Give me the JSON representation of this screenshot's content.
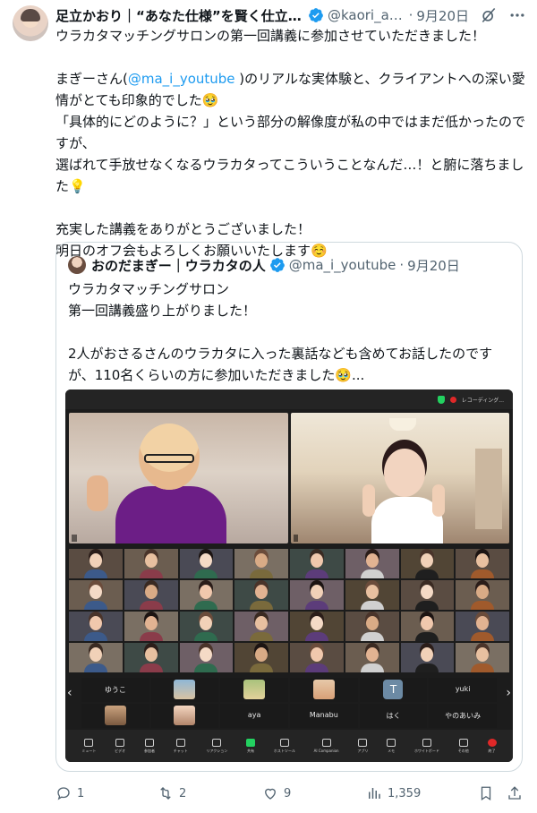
{
  "author": {
    "name": "足立かおり｜“あなた仕様”を賢く仕立て...",
    "handle": "@kaori_as...",
    "dot": "·",
    "date": "9月20日"
  },
  "tweet": {
    "line1": "ウラカタマッチングサロンの第一回講義に参加させていただきました！\n\nまぎーさん(",
    "mention": "@ma_i_youtube",
    "line2": " )のリアルな実体験と、クライアントへの深い愛情がとても印象的でした🥹\n「具体的にどのように？」という部分の解像度が私の中ではまだ低かったのですが、\n選ばれて手放せなくなるウラカタってこういうことなんだ…！と腑に落ちました💡\n\n充実した講義をありがとうございました！\n明日のオフ会もよろしくお願いいたします☺️"
  },
  "quote": {
    "name": "おのだまぎー｜ウラカタの人",
    "handle": "@ma_i_youtube",
    "dot": "·",
    "date": "9月20日",
    "text": "ウラカタマッチングサロン\n第一回講義盛り上がりました！\n\n2人がおさるさんのウラカタに入った裏話なども含めてお話したのですが、110名くらいの方に参加いただきました🥹..."
  },
  "zoom": {
    "recording_label": "レコーディング...",
    "strip_row1": [
      "ゆうこ",
      "",
      "",
      "",
      "T",
      "yuki"
    ],
    "strip_row2": [
      "",
      "",
      "aya",
      "Manabu",
      "はく",
      "やのあいみ"
    ],
    "toolbar": [
      "ミュート",
      "ビデオ",
      "参加者",
      "チャット",
      "リアクション",
      "共有",
      "ホストツール",
      "AI Companion",
      "アプリ",
      "メモ",
      "ホワイトボード",
      "その他",
      "終了"
    ]
  },
  "metrics": {
    "replies": "1",
    "retweets": "2",
    "likes": "9",
    "views": "1,359"
  }
}
